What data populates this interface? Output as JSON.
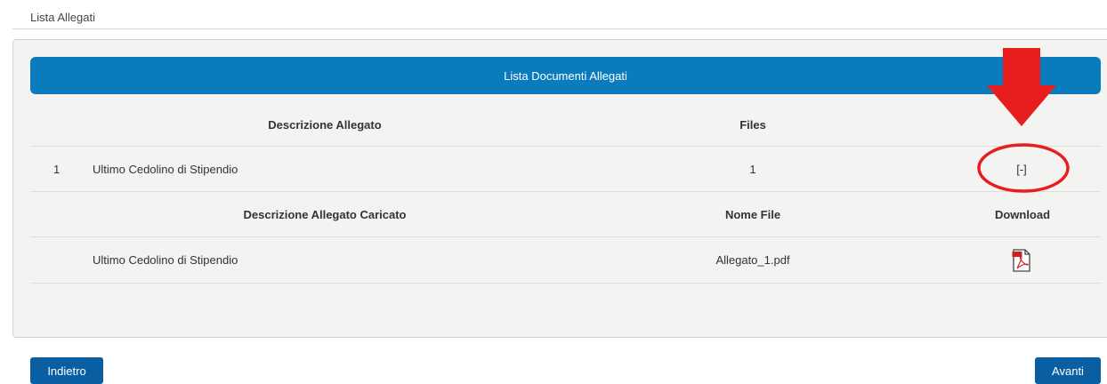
{
  "section": {
    "title": "Lista Allegati"
  },
  "panel": {
    "header": "Lista Documenti Allegati",
    "columns": {
      "description": "Descrizione Allegato",
      "files": "Files"
    },
    "rows": [
      {
        "index": "1",
        "description": "Ultimo Cedolino di Stipendio",
        "files": "1",
        "toggle": "[-]"
      }
    ],
    "uploaded": {
      "columns": {
        "description": "Descrizione Allegato Caricato",
        "filename": "Nome File",
        "download": "Download"
      },
      "rows": [
        {
          "description": "Ultimo Cedolino di Stipendio",
          "filename": "Allegato_1.pdf",
          "download_icon": "pdf-icon"
        }
      ]
    }
  },
  "buttons": {
    "back": "Indietro",
    "next": "Avanti"
  },
  "annotation": {
    "arrow_color": "#e81d1d",
    "circle_color": "#e81d1d"
  },
  "colors": {
    "header_bar": "#0a7bbd",
    "buttons": "#0a5fa3",
    "panel_bg": "#f3f3f1"
  }
}
